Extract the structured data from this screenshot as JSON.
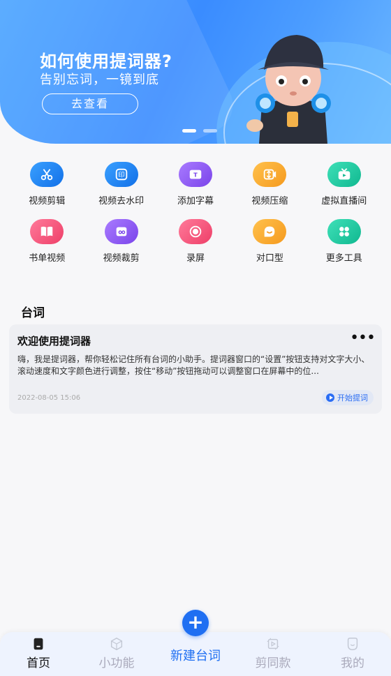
{
  "banner": {
    "title": "如何使用提词器?",
    "subtitle": "告别忘词，一镜到底",
    "button_label": "去查看"
  },
  "tools": [
    {
      "label": "视频剪辑",
      "icon": "scissors-icon",
      "color": "#1e88f5"
    },
    {
      "label": "视频去水印",
      "icon": "watermark-icon",
      "color": "#1e88f5"
    },
    {
      "label": "添加字幕",
      "icon": "subtitle-icon",
      "color": "#8a5cf0"
    },
    {
      "label": "视频压缩",
      "icon": "compress-icon",
      "color": "#f5a623"
    },
    {
      "label": "虚拟直播间",
      "icon": "tv-icon",
      "color": "#1bc9a3"
    },
    {
      "label": "书单视频",
      "icon": "book-icon",
      "color": "#f2557a"
    },
    {
      "label": "视频裁剪",
      "icon": "crop-icon",
      "color": "#8a5cf0"
    },
    {
      "label": "录屏",
      "icon": "record-icon",
      "color": "#f2557a"
    },
    {
      "label": "对口型",
      "icon": "lip-sync-icon",
      "color": "#f5a623"
    },
    {
      "label": "更多工具",
      "icon": "grid-icon",
      "color": "#1bc9a3"
    }
  ],
  "section": {
    "title": "台词"
  },
  "card": {
    "title": "欢迎使用提词器",
    "body": "嗨，我是提词器，帮你轻松记住所有台词的小助手。提词器窗口的“设置”按钮支持对文字大小、滚动速度和文字颜色进行调整，按住“移动”按钮拖动可以调整窗口在屏幕中的位...",
    "date": "2022-08-05 15:06",
    "action_label": "开始提词"
  },
  "nav": {
    "home": "首页",
    "features": "小功能",
    "new": "新建台词",
    "templates": "剪同款",
    "profile": "我的"
  },
  "colors": {
    "accent": "#1f6ff2"
  }
}
